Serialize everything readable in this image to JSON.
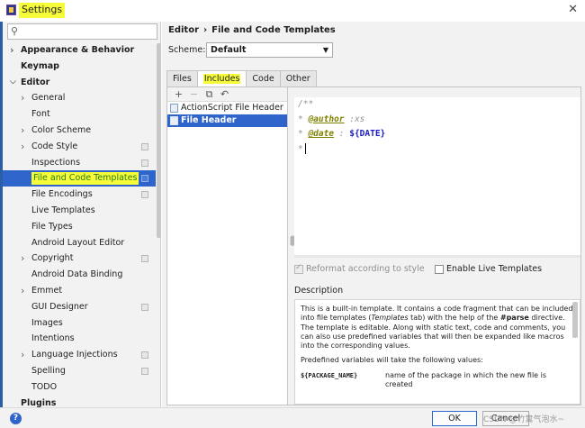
{
  "window": {
    "title": "Settings",
    "close_glyph": "✕"
  },
  "search": {
    "placeholder": "",
    "icon": "search-icon"
  },
  "sidebar": {
    "items": [
      {
        "label": "Appearance & Behavior",
        "level": 0,
        "arrow": "right",
        "bold": true,
        "cfg": false
      },
      {
        "label": "Keymap",
        "level": 0,
        "arrow": "none",
        "bold": true,
        "cfg": false
      },
      {
        "label": "Editor",
        "level": 0,
        "arrow": "down",
        "bold": true,
        "cfg": false
      },
      {
        "label": "General",
        "level": 1,
        "arrow": "right",
        "bold": false,
        "cfg": false
      },
      {
        "label": "Font",
        "level": 1,
        "arrow": "none",
        "bold": false,
        "cfg": false
      },
      {
        "label": "Color Scheme",
        "level": 1,
        "arrow": "right",
        "bold": false,
        "cfg": false
      },
      {
        "label": "Code Style",
        "level": 1,
        "arrow": "right",
        "bold": false,
        "cfg": true
      },
      {
        "label": "Inspections",
        "level": 1,
        "arrow": "none",
        "bold": false,
        "cfg": true
      },
      {
        "label": "File and Code Templates",
        "level": 1,
        "arrow": "none",
        "bold": false,
        "cfg": true,
        "selected": true
      },
      {
        "label": "File Encodings",
        "level": 1,
        "arrow": "none",
        "bold": false,
        "cfg": true
      },
      {
        "label": "Live Templates",
        "level": 1,
        "arrow": "none",
        "bold": false,
        "cfg": false
      },
      {
        "label": "File Types",
        "level": 1,
        "arrow": "none",
        "bold": false,
        "cfg": false
      },
      {
        "label": "Android Layout Editor",
        "level": 1,
        "arrow": "none",
        "bold": false,
        "cfg": false
      },
      {
        "label": "Copyright",
        "level": 1,
        "arrow": "right",
        "bold": false,
        "cfg": true
      },
      {
        "label": "Android Data Binding",
        "level": 1,
        "arrow": "none",
        "bold": false,
        "cfg": false
      },
      {
        "label": "Emmet",
        "level": 1,
        "arrow": "right",
        "bold": false,
        "cfg": false
      },
      {
        "label": "GUI Designer",
        "level": 1,
        "arrow": "none",
        "bold": false,
        "cfg": true
      },
      {
        "label": "Images",
        "level": 1,
        "arrow": "none",
        "bold": false,
        "cfg": false
      },
      {
        "label": "Intentions",
        "level": 1,
        "arrow": "none",
        "bold": false,
        "cfg": false
      },
      {
        "label": "Language Injections",
        "level": 1,
        "arrow": "right",
        "bold": false,
        "cfg": true
      },
      {
        "label": "Spelling",
        "level": 1,
        "arrow": "none",
        "bold": false,
        "cfg": true
      },
      {
        "label": "TODO",
        "level": 1,
        "arrow": "none",
        "bold": false,
        "cfg": false
      },
      {
        "label": "Plugins",
        "level": 0,
        "arrow": "none",
        "bold": true,
        "cfg": false
      }
    ]
  },
  "breadcrumb": {
    "parent": "Editor",
    "separator": "›",
    "current": "File and Code Templates"
  },
  "scheme": {
    "label": "Scheme:",
    "value": "Default"
  },
  "tabs": [
    {
      "label": "Files",
      "active": false,
      "highlighted": false
    },
    {
      "label": "Includes",
      "active": true,
      "highlighted": true
    },
    {
      "label": "Code",
      "active": false,
      "highlighted": false
    },
    {
      "label": "Other",
      "active": false,
      "highlighted": false
    }
  ],
  "toolbar": {
    "add": "+",
    "remove": "−",
    "copy": "⧉",
    "reset": "↶"
  },
  "templates": [
    {
      "name": "ActionScript File Header",
      "selected": false
    },
    {
      "name": "File Header",
      "selected": true
    }
  ],
  "editor": {
    "line1": "/**",
    "line2_prefix": " * ",
    "line2_tag": "@author",
    "line2_rest": " :xs",
    "line3_prefix": " * ",
    "line3_tag": "@date",
    "line3_sep": " : ",
    "line3_var": "${DATE}",
    "line4": " *"
  },
  "options": {
    "reformat_label": "Reformat according to style",
    "reformat_checked": true,
    "live_templates_label": "Enable Live Templates",
    "live_templates_checked": false
  },
  "description": {
    "label": "Description",
    "p1_a": "This is a built-in template. It contains a code fragment that can be included into file templates (",
    "p1_b": "Templates",
    "p1_c": " tab) with the help of the ",
    "p1_d": "#parse",
    "p1_e": " directive. The template is editable. Along with static text, code and comments, you can also use predefined variables that will then be expanded like macros into the corresponding values.",
    "p2": "Predefined variables will take the following values:",
    "var_name": "${PACKAGE_NAME}",
    "var_desc": "name of the package in which the new file is created"
  },
  "buttons": {
    "ok": "OK",
    "cancel": "Cancel"
  },
  "watermark": "CSDN @竹篱气泡水~",
  "colors": {
    "selection": "#2f65ca",
    "highlight": "#f6fb3a",
    "highlight_text": "#2b7d15"
  }
}
